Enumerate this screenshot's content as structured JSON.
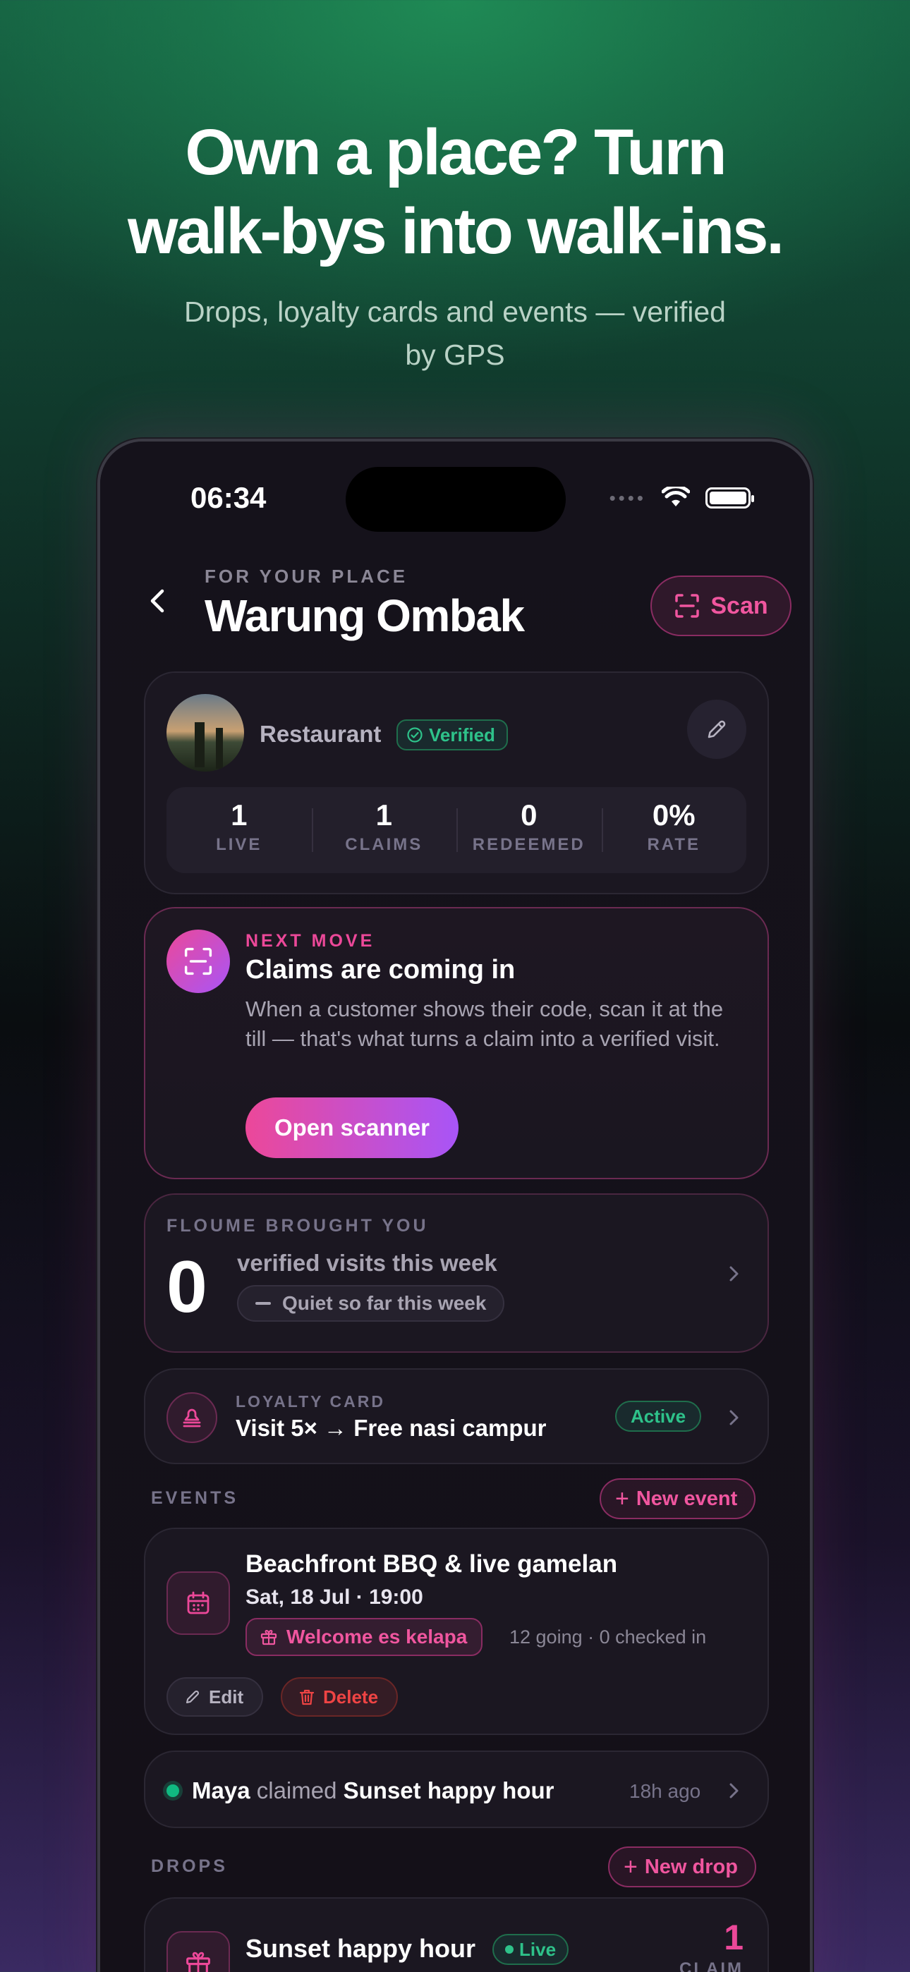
{
  "marketing": {
    "headline_line1": "Own a place? Turn",
    "headline_line2": "walk-bys into walk-ins.",
    "subline_line1": "Drops, loyalty cards and events — verified",
    "subline_line2": "by GPS"
  },
  "status_bar": {
    "time": "06:34",
    "signal_dots": "••••"
  },
  "header": {
    "eyebrow": "FOR YOUR PLACE",
    "title": "Warung Ombak",
    "scan_label": "Scan"
  },
  "profile": {
    "category": "Restaurant",
    "verified_label": "Verified",
    "stats": [
      {
        "value": "1",
        "label": "LIVE"
      },
      {
        "value": "1",
        "label": "CLAIMS"
      },
      {
        "value": "0",
        "label": "REDEEMED"
      },
      {
        "value": "0%",
        "label": "RATE"
      }
    ]
  },
  "next_move": {
    "eyebrow": "NEXT MOVE",
    "title": "Claims are coming in",
    "body": "When a customer shows their code, scan it at the till — that's what turns a claim into a verified visit.",
    "button_label": "Open scanner"
  },
  "brought": {
    "eyebrow": "FLOUME BROUGHT YOU",
    "count": "0",
    "text": "verified visits this week",
    "chip": "Quiet so far this week"
  },
  "loyalty": {
    "eyebrow": "LOYALTY CARD",
    "title": "Visit 5× → Free nasi campur",
    "status": "Active"
  },
  "events": {
    "section_label": "EVENTS",
    "new_label": "New event",
    "items": [
      {
        "title": "Beachfront BBQ & live gamelan",
        "date": "Sat, 18 Jul · 19:00",
        "perk": "Welcome es kelapa",
        "going": "12 going · 0 checked in",
        "edit_label": "Edit",
        "delete_label": "Delete"
      }
    ]
  },
  "activity": {
    "user": "Maya",
    "verb": "claimed",
    "item": "Sunset happy hour",
    "time": "18h ago"
  },
  "drops": {
    "section_label": "DROPS",
    "new_label": "New drop",
    "items": [
      {
        "title": "Sunset happy hour",
        "status": "Live",
        "claims": "1",
        "claims_label": "CLAIM"
      }
    ]
  },
  "colors": {
    "accent_pink": "#ec4899",
    "accent_purple": "#a855f7",
    "success_green": "#2ec28a",
    "danger_red": "#ef4444"
  }
}
